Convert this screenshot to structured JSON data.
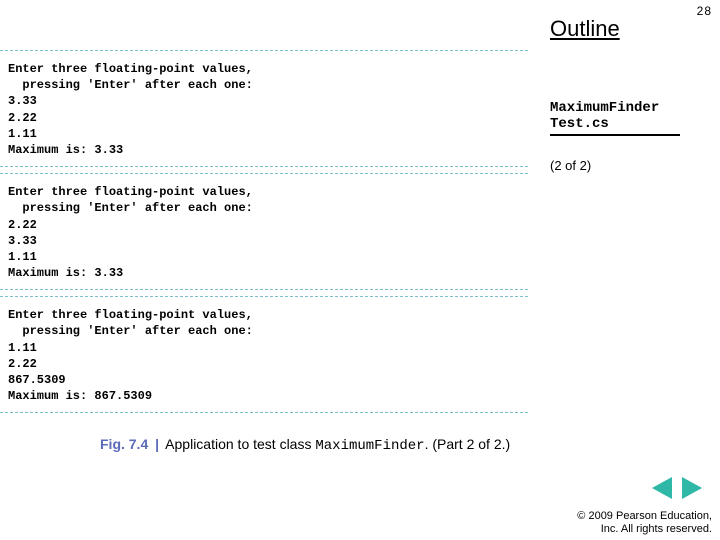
{
  "page_number": "28",
  "outline_title": "Outline",
  "filename": {
    "line1": "MaximumFinder",
    "line2": "Test.cs"
  },
  "page_of": "(2 of 2)",
  "outputs": [
    "Enter three floating-point values,\n  pressing 'Enter' after each one:\n3.33\n2.22\n1.11\nMaximum is: 3.33",
    "Enter three floating-point values,\n  pressing 'Enter' after each one:\n2.22\n3.33\n1.11\nMaximum is: 3.33",
    "Enter three floating-point values,\n  pressing 'Enter' after each one:\n1.11\n2.22\n867.5309\nMaximum is: 867.5309"
  ],
  "caption": {
    "label": "Fig. 7.4",
    "sep": "|",
    "text_pre": "Application to test class ",
    "code": "MaximumFinder",
    "text_post": ". (Part 2 of 2.)"
  },
  "copyright": {
    "line1": "© 2009 Pearson Education,",
    "line2": "Inc.  All rights reserved."
  }
}
